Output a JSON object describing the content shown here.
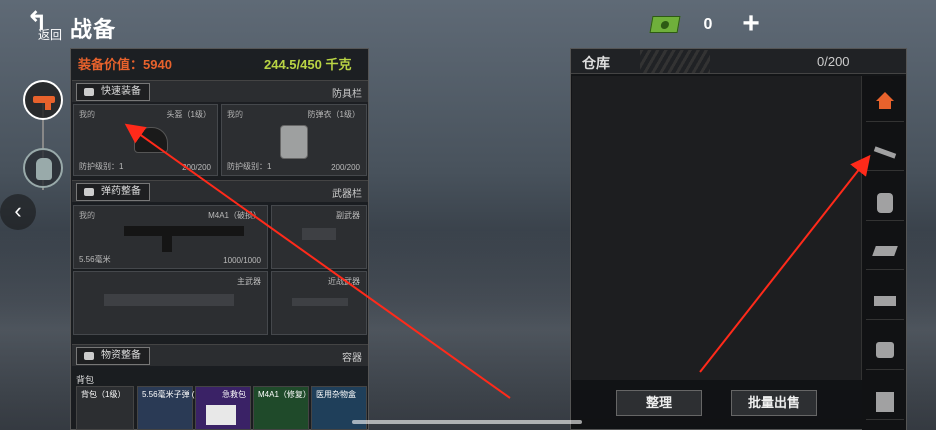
{
  "header": {
    "back_arrow": "↰",
    "back_label": "返回",
    "title": "战备",
    "money": "0",
    "add_symbol": "+"
  },
  "side": {
    "left_arrow": "‹"
  },
  "equipment": {
    "value_label": "装备价值：5940",
    "weight_label": "244.5/450 千克",
    "quick_equip_label": "快速装备",
    "armor_section": "防具栏",
    "helmet": {
      "owner": "我的",
      "name": "头盔（1级）",
      "protection": "防护级别：1",
      "durability": "200/200"
    },
    "vest": {
      "owner": "我的",
      "name": "防弹衣（1级）",
      "protection": "防护级别：1",
      "durability": "200/200"
    },
    "ammo_label": "弹药整备",
    "weapon_section": "武器栏",
    "rifle": {
      "owner": "我的",
      "name": "M4A1（破损）",
      "ammo": "5.56毫米",
      "durability": "1000/1000"
    },
    "secondary_label": "副武器",
    "primary_label": "主武器",
    "melee_label": "近战武器",
    "supply_label": "物资整备",
    "container_section": "容器",
    "backpack_label": "背包",
    "pack_items": [
      {
        "name": "背包（1级）"
      },
      {
        "name": "5.56毫米子弹 (曳光)"
      },
      {
        "name": "急救包"
      },
      {
        "name": "M4A1（修复）"
      },
      {
        "name": "医用杂物盒"
      }
    ]
  },
  "warehouse": {
    "title": "仓库",
    "capacity": "0/200",
    "organize_label": "整理",
    "bulk_sell_label": "批量出售",
    "categories": [
      "home-icon",
      "rifle-icon",
      "vest-icon",
      "ammo-icon",
      "weapon-case-icon",
      "medkit-icon",
      "supply-box-icon"
    ]
  },
  "colors": {
    "accent": "#e8622c",
    "weight": "#b9d444",
    "annotation": "#ff2a1a"
  }
}
